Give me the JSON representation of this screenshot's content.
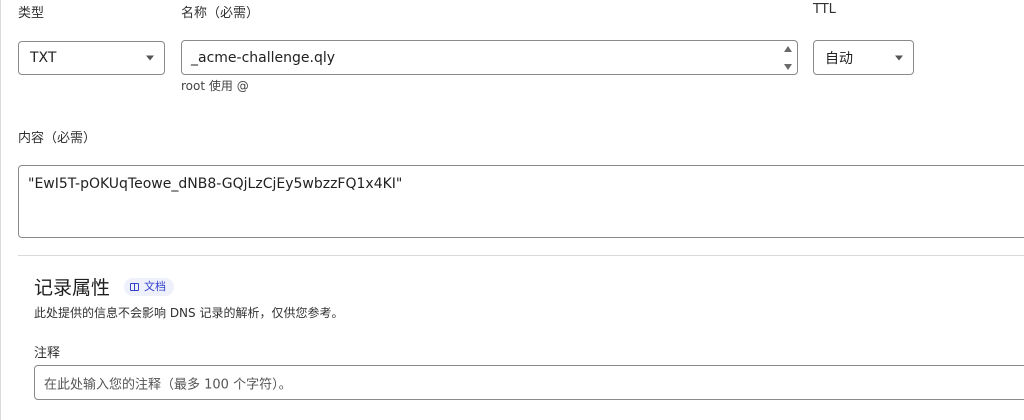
{
  "type_field": {
    "label": "类型",
    "value": "TXT"
  },
  "name_field": {
    "label": "名称（必需）",
    "value": "_acme-challenge.qly",
    "hint": "root 使用 @"
  },
  "ttl_field": {
    "label": "TTL",
    "value": "自动"
  },
  "content_field": {
    "label": "内容（必需）",
    "value": "\"EwI5T-pOKUqTeowe_dNB8-GQjLzCjEy5wbzzFQ1x4KI\""
  },
  "record_attributes": {
    "title": "记录属性",
    "docs_label": "文档",
    "description": "此处提供的信息不会影响 DNS 记录的解析，仅供您参考。",
    "comment_label": "注释",
    "comment_placeholder": "在此处输入您的注释（最多 100 个字符）。"
  },
  "icons": {
    "type_dropdown": "chevron-down-icon",
    "ttl_dropdown": "chevron-down-icon",
    "name_spinner": "spinner-icon",
    "docs": "book-icon"
  },
  "colors": {
    "border": "#8a8a8a",
    "divider": "#d9d9d9",
    "badge_bg": "#eef0fc",
    "badge_text": "#3442c9"
  }
}
